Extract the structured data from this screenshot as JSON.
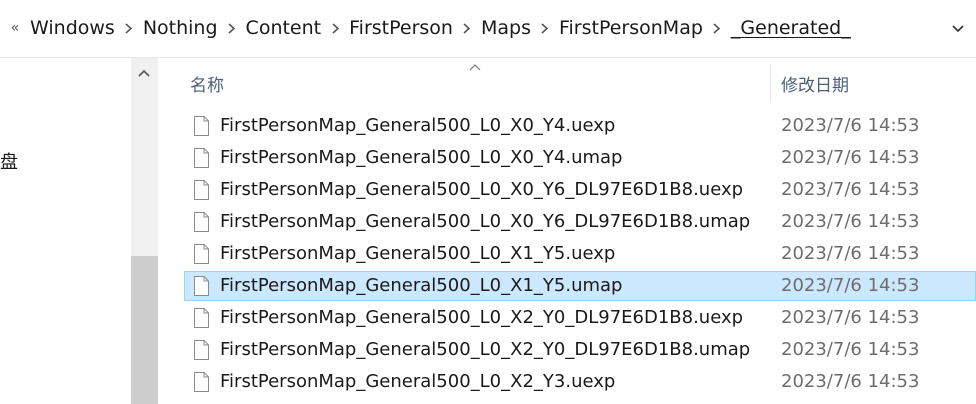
{
  "address_bar": {
    "overflow_glyph": "«",
    "crumbs": [
      "Windows",
      "Nothing",
      "Content",
      "FirstPerson",
      "Maps",
      "FirstPersonMap",
      "_Generated_"
    ]
  },
  "nav_pane": {
    "partial_item_text": "盘"
  },
  "file_list": {
    "columns": {
      "name": "名称",
      "date_modified": "修改日期"
    },
    "sort": {
      "column": "name",
      "direction": "ascending"
    },
    "selected_index": 5,
    "files": [
      {
        "name": "FirstPersonMap_General500_L0_X0_Y4.uexp",
        "date": "2023/7/6 14:53"
      },
      {
        "name": "FirstPersonMap_General500_L0_X0_Y4.umap",
        "date": "2023/7/6 14:53"
      },
      {
        "name": "FirstPersonMap_General500_L0_X0_Y6_DL97E6D1B8.uexp",
        "date": "2023/7/6 14:53"
      },
      {
        "name": "FirstPersonMap_General500_L0_X0_Y6_DL97E6D1B8.umap",
        "date": "2023/7/6 14:53"
      },
      {
        "name": "FirstPersonMap_General500_L0_X1_Y5.uexp",
        "date": "2023/7/6 14:53"
      },
      {
        "name": "FirstPersonMap_General500_L0_X1_Y5.umap",
        "date": "2023/7/6 14:53"
      },
      {
        "name": "FirstPersonMap_General500_L0_X2_Y0_DL97E6D1B8.uexp",
        "date": "2023/7/6 14:53"
      },
      {
        "name": "FirstPersonMap_General500_L0_X2_Y0_DL97E6D1B8.umap",
        "date": "2023/7/6 14:53"
      },
      {
        "name": "FirstPersonMap_General500_L0_X2_Y3.uexp",
        "date": "2023/7/6 14:53"
      }
    ]
  },
  "colors": {
    "selection_fill": "#cce8ff",
    "selection_border": "#99d1ff",
    "header_text": "#4c607a",
    "date_text": "#6d6d6d"
  },
  "icons": {
    "crumb_separator": "chevron-right-icon",
    "address_dropdown": "chevron-down-icon",
    "file": "file-icon",
    "sort": "sort-ascending-icon",
    "nav_scroll_up": "scroll-up-icon"
  }
}
